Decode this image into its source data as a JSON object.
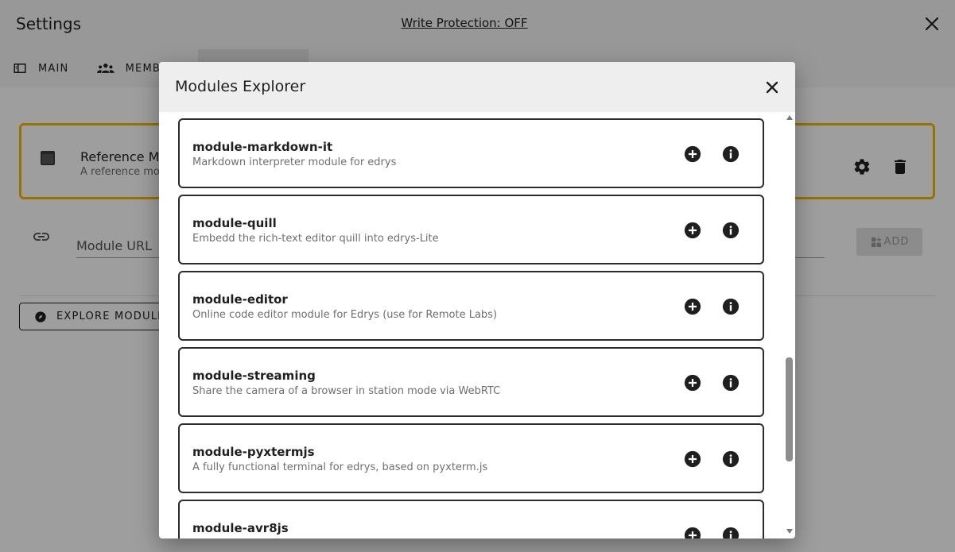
{
  "settings": {
    "title": "Settings",
    "write_protection": "Write Protection: OFF",
    "tabs": [
      {
        "label": "MAIN",
        "icon": "layout-sidebar-icon"
      },
      {
        "label": "MEMB",
        "icon": "group-icon"
      }
    ],
    "module_card": {
      "title": "Reference Mo",
      "description": "A reference mo"
    },
    "module_url": {
      "label": "Module URL"
    },
    "add_button": "ADD",
    "explore_button": "EXPLORE MODULE"
  },
  "dialog": {
    "title": "Modules Explorer",
    "modules": [
      {
        "name": "module-markdown-it",
        "description": "Markdown interpreter module for edrys"
      },
      {
        "name": "module-quill",
        "description": "Embedd the rich-text editor quill into edrys-Lite"
      },
      {
        "name": "module-editor",
        "description": "Online code editor module for Edrys (use for Remote Labs)"
      },
      {
        "name": "module-streaming",
        "description": "Share the camera of a browser in station mode via WebRTC"
      },
      {
        "name": "module-pyxtermjs",
        "description": "A fully functional terminal for edrys, based on pyxterm.js"
      },
      {
        "name": "module-avr8js",
        "description": ""
      }
    ]
  },
  "colors": {
    "accent": "#f5b800",
    "overlay": "rgba(0,0,0,0.38)"
  }
}
